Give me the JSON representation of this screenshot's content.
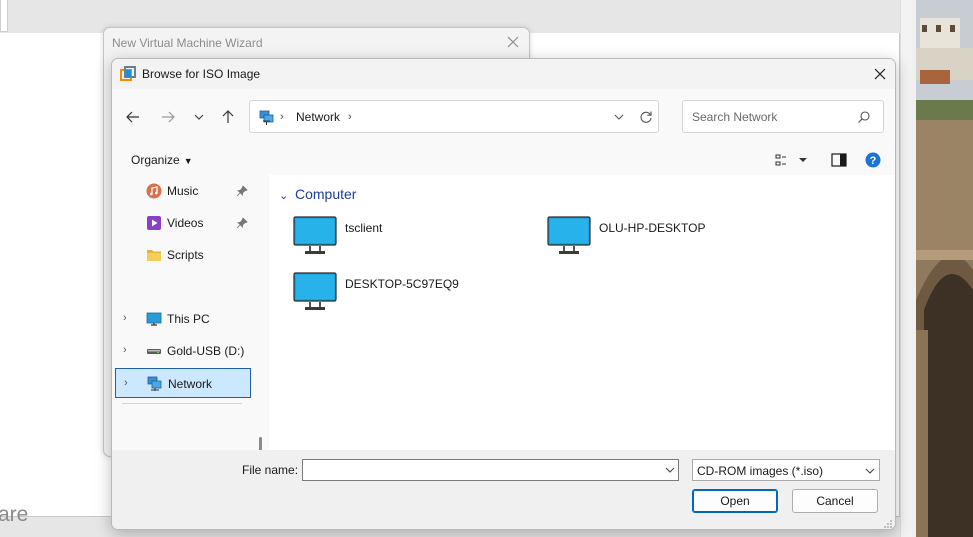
{
  "background_app": {
    "brand_fragment": "are"
  },
  "wizard": {
    "title": "New Virtual Machine Wizard"
  },
  "dialog": {
    "title": "Browse for ISO Image",
    "address": {
      "location": "Network"
    },
    "search": {
      "placeholder": "Search Network"
    },
    "toolbar": {
      "organize_label": "Organize"
    },
    "nav_pane": {
      "quick_access": [
        {
          "label": "Music",
          "icon": "music-icon",
          "pinned": true
        },
        {
          "label": "Videos",
          "icon": "videos-icon",
          "pinned": true
        },
        {
          "label": "Scripts",
          "icon": "folder-icon",
          "pinned": false
        }
      ],
      "locations": [
        {
          "label": "This PC",
          "icon": "computer-icon"
        },
        {
          "label": "Gold-USB (D:)",
          "icon": "usb-drive-icon"
        },
        {
          "label": "Network",
          "icon": "network-icon",
          "selected": true
        }
      ]
    },
    "content": {
      "group_label": "Computer",
      "items": [
        {
          "label": "tsclient",
          "icon": "monitor-icon"
        },
        {
          "label": "OLU-HP-DESKTOP",
          "icon": "monitor-icon"
        },
        {
          "label": "DESKTOP-5C97EQ9",
          "icon": "monitor-icon"
        }
      ]
    },
    "footer": {
      "file_name_label": "File name:",
      "file_name_value": "",
      "file_type": "CD-ROM images (*.iso)",
      "open_label": "Open",
      "cancel_label": "Cancel"
    }
  },
  "colors": {
    "accent": "#0067c0",
    "selection": "#cce8ff",
    "group_header": "#1d3f99"
  }
}
